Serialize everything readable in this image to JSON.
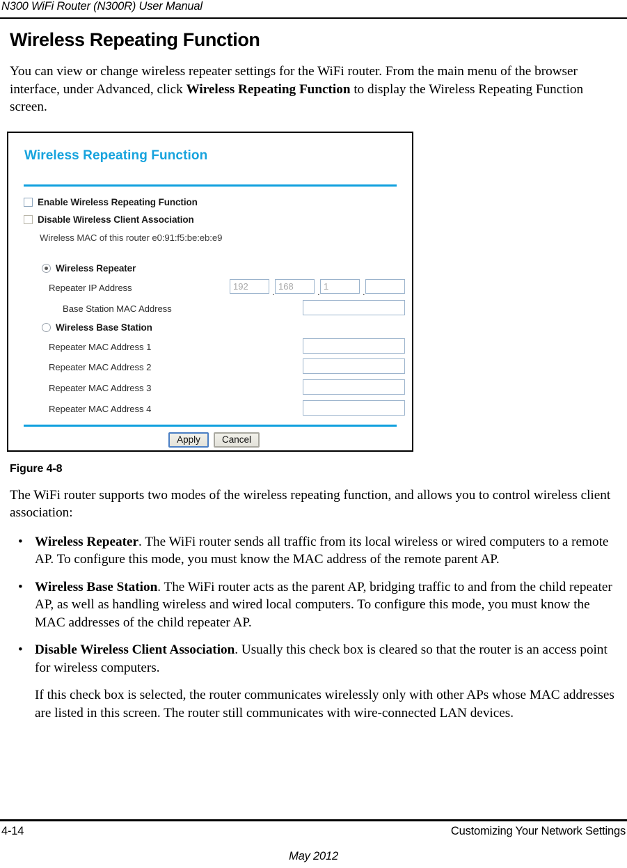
{
  "header": {
    "running_title": "N300 WiFi Router (N300R) User Manual"
  },
  "section": {
    "title": "Wireless Repeating Function",
    "intro_part1": "You can view or change wireless repeater settings for the WiFi router. From the main menu of the browser interface, under Advanced, click ",
    "intro_bold": "Wireless Repeating Function",
    "intro_part2": " to display the Wireless Repeating Function screen."
  },
  "figure": {
    "caption": "Figure 4-8",
    "ui": {
      "title": "Wireless Repeating Function",
      "accent_color": "#10a0de",
      "checkbox_enable_label": "Enable Wireless Repeating Function",
      "checkbox_enable_checked": false,
      "checkbox_disable_label": "Disable Wireless Client Association",
      "checkbox_disable_checked": false,
      "mac_note": "Wireless MAC of this router e0:91:f5:be:eb:e9",
      "radio_repeater_label": "Wireless Repeater",
      "radio_repeater_selected": true,
      "repeater_ip_label": "Repeater IP Address",
      "repeater_ip_octets": [
        "192",
        "168",
        "1",
        ""
      ],
      "base_station_mac_label": "Base Station MAC Address",
      "base_station_mac_value": "",
      "radio_base_station_label": "Wireless Base Station",
      "radio_base_station_selected": false,
      "repeater_mac_rows": [
        {
          "label": "Repeater MAC Address 1",
          "value": ""
        },
        {
          "label": "Repeater MAC Address 2",
          "value": ""
        },
        {
          "label": "Repeater MAC Address 3",
          "value": ""
        },
        {
          "label": "Repeater MAC Address 4",
          "value": ""
        }
      ],
      "apply_button": "Apply",
      "cancel_button": "Cancel"
    }
  },
  "body": {
    "lead_para": "The WiFi router supports two modes of the wireless repeating function, and allows you to control wireless client association:",
    "bullets": [
      {
        "marker": "•",
        "bold": "Wireless Repeater",
        "text": ". The WiFi router sends all traffic from its local wireless or wired computers to a remote AP. To configure this mode, you must know the MAC address of the remote parent AP."
      },
      {
        "marker": "•",
        "bold": "Wireless Base Station",
        "text": ". The WiFi router acts as the parent AP, bridging traffic to and from the child repeater AP, as well as handling wireless and wired local computers. To configure this mode, you must know the MAC addresses of the child repeater AP."
      },
      {
        "marker": "•",
        "bold": "Disable Wireless Client Association",
        "text": ". Usually this check box is cleared so that the router is an access point for wireless computers."
      }
    ],
    "closing_para": "If this check box is selected, the router communicates wirelessly only with other APs whose MAC addresses are listed in this screen. The router still communicates with wire-connected LAN devices."
  },
  "footer": {
    "page_number": "4-14",
    "chapter_title": "Customizing Your Network Settings",
    "date": "May 2012"
  }
}
